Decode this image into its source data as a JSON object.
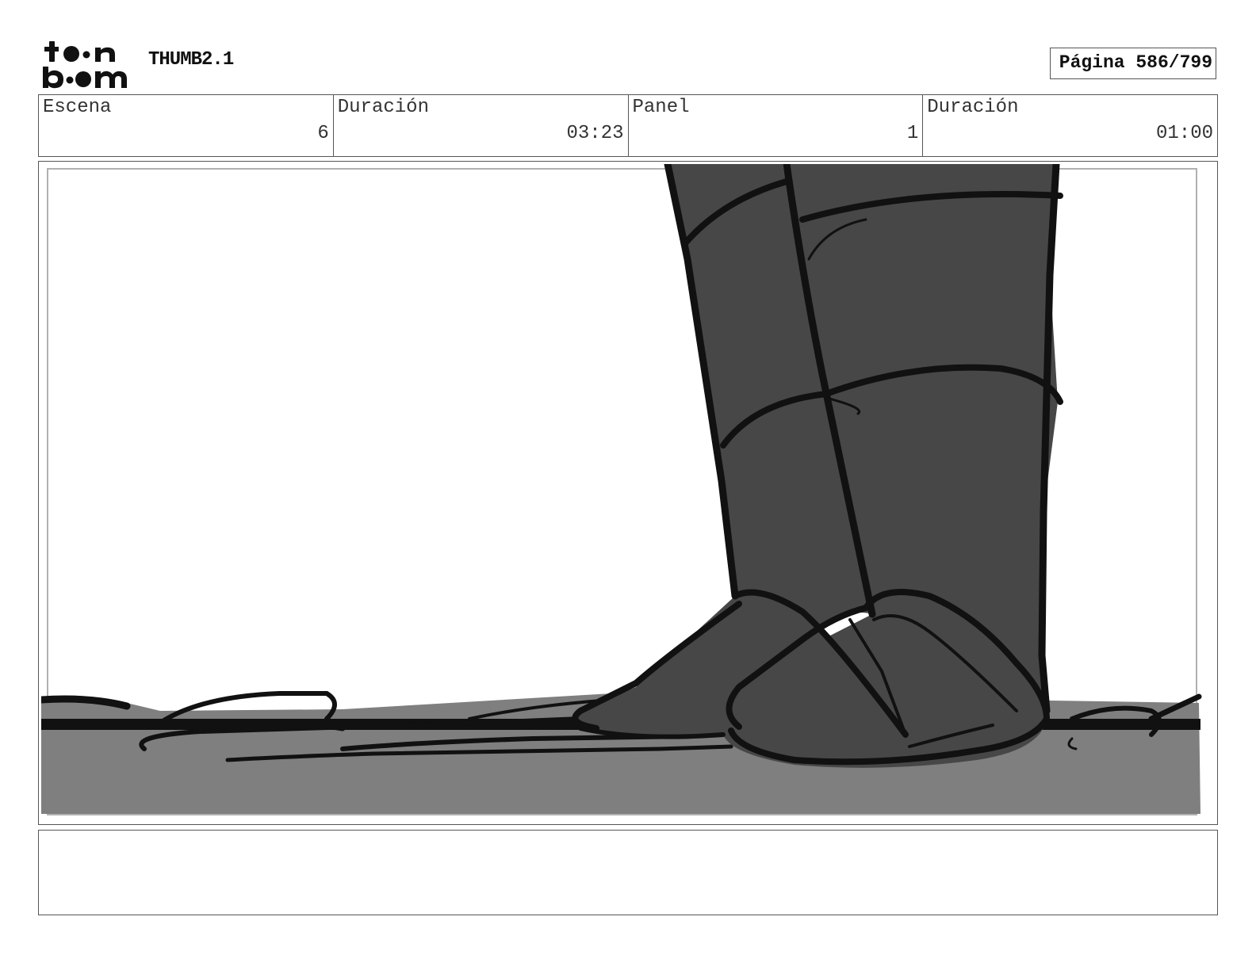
{
  "header": {
    "logo_top": "t•n",
    "logo_bottom": "b•m",
    "project_title": "THUMB2.1",
    "page_counter": "Página 586/799"
  },
  "info": {
    "scene_label": "Escena",
    "scene_value": "6",
    "scene_duration_label": "Duración",
    "scene_duration_value": "03:23",
    "panel_label": "Panel",
    "panel_value": "1",
    "panel_duration_label": "Duración",
    "panel_duration_value": "01:00"
  },
  "panel": {
    "content": "storyboard sketch of legs and feet standing on the ground",
    "colors": {
      "background": "#ffffff",
      "ground": "#7f7f7f",
      "figure": "#474747",
      "ink": "#111111"
    }
  },
  "notes": {
    "text": ""
  }
}
